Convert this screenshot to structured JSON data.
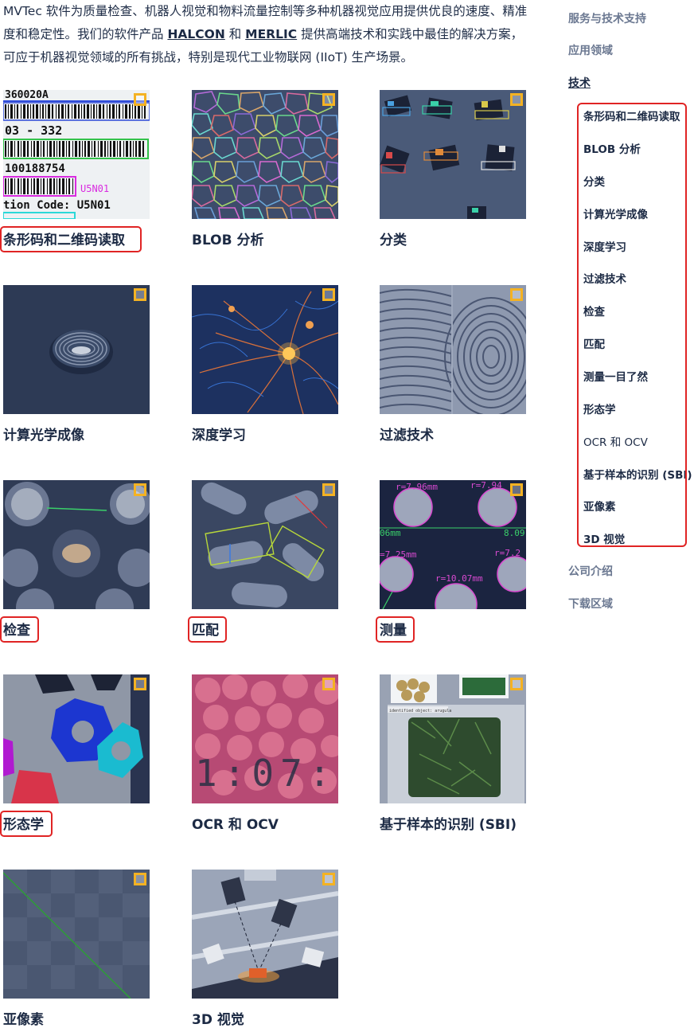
{
  "intro": {
    "text_1": "MVTec 软件为质量检查、机器人视觉和物料流量控制等多种机器视觉应用提供优良的速度、精准度和稳定性。我们的软件产品 ",
    "link_halcon": "HALCON",
    "text_2": " 和 ",
    "link_merlic": "MERLIC",
    "text_3": " 提供高端技术和实践中最佳的解决方案，可应于机器视觉领域的所有挑战，特别是现代工业物联网 (IIoT) 生产场景。"
  },
  "tiles": [
    {
      "label": "条形码和二维码读取",
      "highlighted": true,
      "icon": "barcode-thumbnail"
    },
    {
      "label": "BLOB 分析",
      "highlighted": false,
      "icon": "blob-thumbnail"
    },
    {
      "label": "分类",
      "highlighted": false,
      "icon": "classification-thumbnail"
    },
    {
      "label": "计算光学成像",
      "highlighted": false,
      "icon": "computational-imaging-thumbnail"
    },
    {
      "label": "深度学习",
      "highlighted": false,
      "icon": "deep-learning-thumbnail"
    },
    {
      "label": "过滤技术",
      "highlighted": false,
      "icon": "fingerprint-thumbnail"
    },
    {
      "label": "检查",
      "highlighted": true,
      "icon": "inspection-thumbnail"
    },
    {
      "label": "匹配",
      "highlighted": true,
      "icon": "matching-thumbnail"
    },
    {
      "label": "测量",
      "highlighted": true,
      "icon": "measuring-thumbnail"
    },
    {
      "label": "形态学",
      "highlighted": true,
      "icon": "morphology-thumbnail"
    },
    {
      "label": "OCR 和 OCV",
      "highlighted": false,
      "icon": "ocr-thumbnail"
    },
    {
      "label": "基于样本的识别 (SBI)",
      "highlighted": false,
      "icon": "sbi-thumbnail"
    },
    {
      "label": "亚像素",
      "highlighted": false,
      "icon": "subpixel-thumbnail"
    },
    {
      "label": "3D 视觉",
      "highlighted": false,
      "icon": "3d-vision-thumbnail"
    }
  ],
  "thumb_text": {
    "barcode": [
      "360020A",
      "03 - 332",
      "100188754",
      "U5N01",
      "tion Code: U5N01"
    ],
    "measure": [
      "r=7.96mm",
      "r=7.94",
      "06mm",
      "8.09",
      "=7.25mm",
      "r=7.2",
      "r=10.07mm"
    ],
    "ocr": "1:07:",
    "sbi_tag": "identified object: arugula"
  },
  "sidebar": {
    "top_items": [
      "服务与技术支持",
      "应用领域",
      "技术"
    ],
    "current": "技术",
    "sub_items": [
      "条形码和二维码读取",
      "BLOB 分析",
      "分类",
      "计算光学成像",
      "深度学习",
      "过滤技术",
      "检查",
      "匹配",
      "测量一目了然",
      "形态学",
      "OCR 和 OCV",
      "基于样本的识别 (SBI)",
      "亚像素",
      "3D 视觉"
    ],
    "bottom_items": [
      "公司介绍",
      "下载区域"
    ]
  },
  "colors": {
    "accent_corner": "#f4b223",
    "highlight": "#e02424",
    "text": "#1c2a44"
  }
}
